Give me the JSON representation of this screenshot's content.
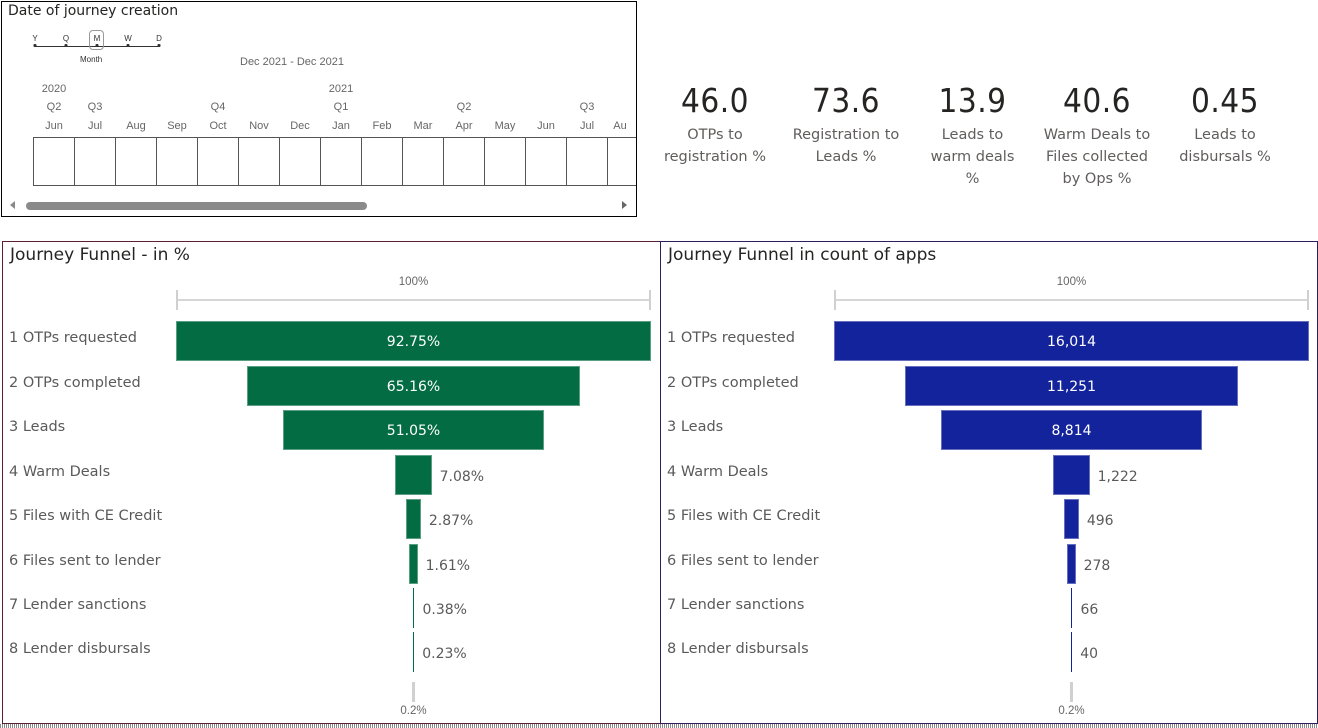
{
  "slicer": {
    "title": "Date of journey creation",
    "granularity": {
      "options": [
        "Y",
        "Q",
        "M",
        "W",
        "D"
      ],
      "selected": "M",
      "selected_caption": "Month"
    },
    "range_label": "Dec 2021 - Dec 2021",
    "years": [
      {
        "label": "2020",
        "col": 0
      },
      {
        "label": "2021",
        "col": 7
      }
    ],
    "quarters": [
      {
        "label": "Q2",
        "col": 0
      },
      {
        "label": "Q3",
        "col": 1
      },
      {
        "label": "Q4",
        "col": 4
      },
      {
        "label": "Q1",
        "col": 7
      },
      {
        "label": "Q2",
        "col": 10
      },
      {
        "label": "Q3",
        "col": 13
      }
    ],
    "months": [
      "Jun",
      "Jul",
      "Aug",
      "Sep",
      "Oct",
      "Nov",
      "Dec",
      "Jan",
      "Feb",
      "Mar",
      "Apr",
      "May",
      "Jun",
      "Jul",
      "Au"
    ]
  },
  "kpis": [
    {
      "value": "46.0",
      "label": "OTPs to registration %"
    },
    {
      "value": "73.6",
      "label": "Registration to Leads %"
    },
    {
      "value": "13.9",
      "label": "Leads to warm deals %"
    },
    {
      "value": "40.6",
      "label": "Warm Deals to Files collected by Ops %"
    },
    {
      "value": "0.45",
      "label": "Leads to disbursals %"
    }
  ],
  "colors": {
    "pct_bar": "#036c42",
    "cnt_bar": "#13239c"
  },
  "chart_data": [
    {
      "type": "bar",
      "subtype": "funnel",
      "title": "Journey Funnel - in %",
      "categories": [
        "1 OTPs requested",
        "2 OTPs completed",
        "3 Leads",
        "4 Warm Deals",
        "5 Files with CE Credit",
        "6 Files sent to lender",
        "7 Lender sanctions",
        "8 Lender disbursals"
      ],
      "values": [
        92.75,
        65.16,
        51.05,
        7.08,
        2.87,
        1.61,
        0.38,
        0.23
      ],
      "value_labels": [
        "92.75%",
        "65.16%",
        "51.05%",
        "7.08%",
        "2.87%",
        "1.61%",
        "0.38%",
        "0.23%"
      ],
      "axis_top_label": "100%",
      "axis_bottom_label": "0.2%",
      "color": "#036c42"
    },
    {
      "type": "bar",
      "subtype": "funnel",
      "title": "Journey Funnel in count of apps",
      "categories": [
        "1 OTPs requested",
        "2 OTPs completed",
        "3 Leads",
        "4 Warm Deals",
        "5 Files with CE Credit",
        "6 Files sent to lender",
        "7 Lender sanctions",
        "8 Lender disbursals"
      ],
      "values": [
        16014,
        11251,
        8814,
        1222,
        496,
        278,
        66,
        40
      ],
      "value_labels": [
        "16,014",
        "11,251",
        "8,814",
        "1,222",
        "496",
        "278",
        "66",
        "40"
      ],
      "axis_top_label": "100%",
      "axis_bottom_label": "0.2%",
      "color": "#13239c"
    }
  ]
}
